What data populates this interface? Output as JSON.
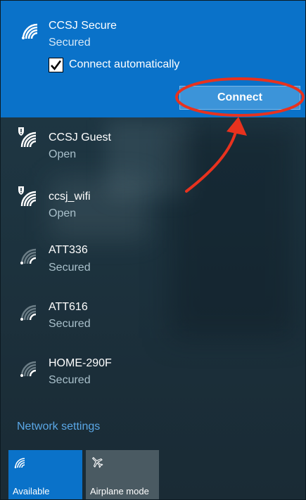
{
  "networks": [
    {
      "name": "CCSJ Secure",
      "status": "Secured",
      "icon": "wifi-signal-icon",
      "selected": true
    },
    {
      "name": "CCSJ Guest",
      "status": "Open",
      "icon": "wifi-open-warning-icon"
    },
    {
      "name": "ccsj_wifi",
      "status": "Open",
      "icon": "wifi-open-warning-icon"
    },
    {
      "name": "ATT336",
      "status": "Secured",
      "icon": "wifi-weak-signal-icon"
    },
    {
      "name": "ATT616",
      "status": "Secured",
      "icon": "wifi-weak-signal-icon"
    },
    {
      "name": "HOME-290F",
      "status": "Secured",
      "icon": "wifi-weak-signal-icon"
    }
  ],
  "connect_auto": {
    "label": "Connect automatically",
    "checked": true
  },
  "connect_button": {
    "label": "Connect"
  },
  "network_settings": {
    "label": "Network settings"
  },
  "quick_actions": [
    {
      "label": "Available",
      "icon": "wifi-icon",
      "active": true
    },
    {
      "label": "Airplane mode",
      "icon": "airplane-icon",
      "active": false
    }
  ],
  "colors": {
    "accent": "#0a72c9",
    "annotation": "#e8321e",
    "link": "#5aa7e6"
  }
}
